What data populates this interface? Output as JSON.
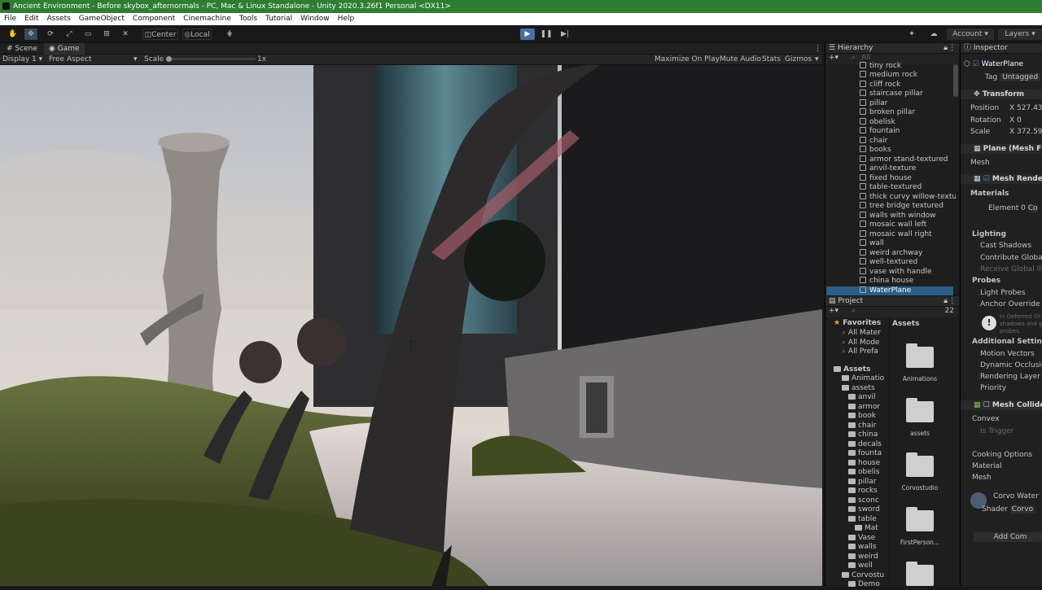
{
  "window": {
    "title": "Ancient Environment - Before skybox_afternormals - PC, Mac & Linux Standalone - Unity 2020.3.26f1 Personal <DX11>"
  },
  "menu": [
    "File",
    "Edit",
    "Assets",
    "GameObject",
    "Component",
    "Cinemachine",
    "Tools",
    "Tutorial",
    "Window",
    "Help"
  ],
  "toolbar": {
    "pivot": "Center",
    "space": "Local",
    "account": "Account",
    "layers": "Layers"
  },
  "tabs": {
    "scene": "Scene",
    "game": "Game"
  },
  "gamebar": {
    "display": "Display 1",
    "aspect": "Free Aspect",
    "scale_label": "Scale",
    "scale_value": "1x",
    "maximize": "Maximize On Play",
    "mute": "Mute Audio",
    "stats": "Stats",
    "gizmos": "Gizmos"
  },
  "hierarchy": {
    "title": "Hierarchy",
    "search": "All",
    "items": [
      "tiny rock",
      "medium rock",
      "cliff rock",
      "staircase pillar",
      "pillar",
      "broken pillar",
      "obelisk",
      "fountain",
      "chair",
      "books",
      "armor stand-textured",
      "anvil-texture",
      "fixed house",
      "table-textured",
      "thick curvy willow-textu",
      "tree bridge textured",
      "walls with window",
      "mosaic wall left",
      "mosaic wall right",
      "wall",
      "weird archway",
      "well-textured",
      "vase with handle",
      "china house",
      "WaterPlane"
    ]
  },
  "project": {
    "title": "Project",
    "count": "22",
    "favorites": "Favorites",
    "fav_items": [
      "All Mater",
      "All Mode",
      "All Prefa"
    ],
    "assets": "Assets",
    "tree": [
      "Animatio",
      "assets",
      "anvil",
      "armor",
      "book",
      "chair",
      "china",
      "decals",
      "founta",
      "house",
      "obelis",
      "pillar",
      "rocks",
      "sconc",
      "sword",
      "table",
      "Mat",
      "Vase",
      "walls",
      "weird",
      "well",
      "Corvostu",
      "Demo"
    ],
    "grid": [
      "Animations",
      "assets",
      "Corvostudio",
      "FirstPerson..."
    ]
  },
  "inspector": {
    "title": "Inspector",
    "object": "WaterPlane",
    "tag_label": "Tag",
    "tag": "Untagged",
    "transform": "Transform",
    "position": "Position",
    "pos_x": "X 527.43",
    "rotation": "Rotation",
    "rot_x": "X 0",
    "scale": "Scale",
    "scale_x": "X 372.59",
    "meshfilter": "Plane (Mesh F",
    "mesh": "Mesh",
    "renderer": "Mesh Render",
    "materials": "Materials",
    "element0": "Element 0",
    "element0_val": "Co",
    "lighting": "Lighting",
    "cast_shadows": "Cast Shadows",
    "contribute": "Contribute Global I",
    "receive": "Receive Global Illu",
    "probes": "Probes",
    "light_probes": "Light Probes",
    "anchor": "Anchor Override",
    "deferred1": "In Deferred Sh",
    "deferred2": "shadows and g",
    "deferred3": "probes.",
    "additional": "Additional Settings",
    "motion": "Motion Vectors",
    "dynamic": "Dynamic Occlusio",
    "rendering_layer": "Rendering Layer M",
    "priority": "Priority",
    "collider": "Mesh Collider",
    "convex": "Convex",
    "trigger": "Is Trigger",
    "cooking": "Cooking Options",
    "material": "Material",
    "mesh2": "Mesh",
    "matname": "Corvo Water",
    "shader": "Shader",
    "shader_val": "Corvo",
    "addcomp": "Add Com"
  }
}
